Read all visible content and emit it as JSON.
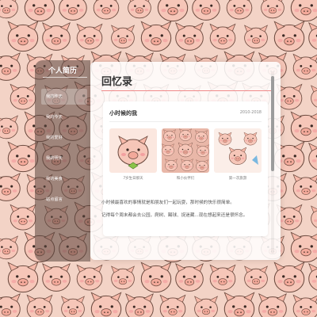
{
  "colors": {
    "background": "#f3d3c6",
    "pig_body": "#f6c6b8",
    "pig_outline": "#6b4a3f",
    "accent_rule": "#f08a8a",
    "sidebar_bg": "rgba(90,70,62,0.55)"
  },
  "sidebar": {
    "title": "个人简历",
    "items": [
      {
        "label": "我的昨天",
        "active": true
      },
      {
        "label": "我的今天",
        "active": false
      },
      {
        "label": "我的爱好",
        "active": false
      },
      {
        "label": "我的明天",
        "active": false
      },
      {
        "label": "我的美食",
        "active": false
      },
      {
        "label": "站点留言",
        "active": false
      }
    ]
  },
  "main": {
    "title": "回忆录",
    "section": {
      "title": "小时候的我",
      "years": "2010-2018",
      "photos": [
        {
          "caption": "7岁生日那天",
          "icon": "pig-face"
        },
        {
          "caption": "和小伙伴们",
          "icon": "pig-crowd"
        },
        {
          "caption": "第一次旅游",
          "icon": "pig-travel"
        }
      ]
    },
    "paragraphs": [
      "小时候最喜欢的事情就是和朋友们一起玩耍，那时候的快乐很简单。",
      "记得每个周末都会去公园，爬树、踢球、捉迷藏...现在想起来还是很怀念。"
    ]
  }
}
